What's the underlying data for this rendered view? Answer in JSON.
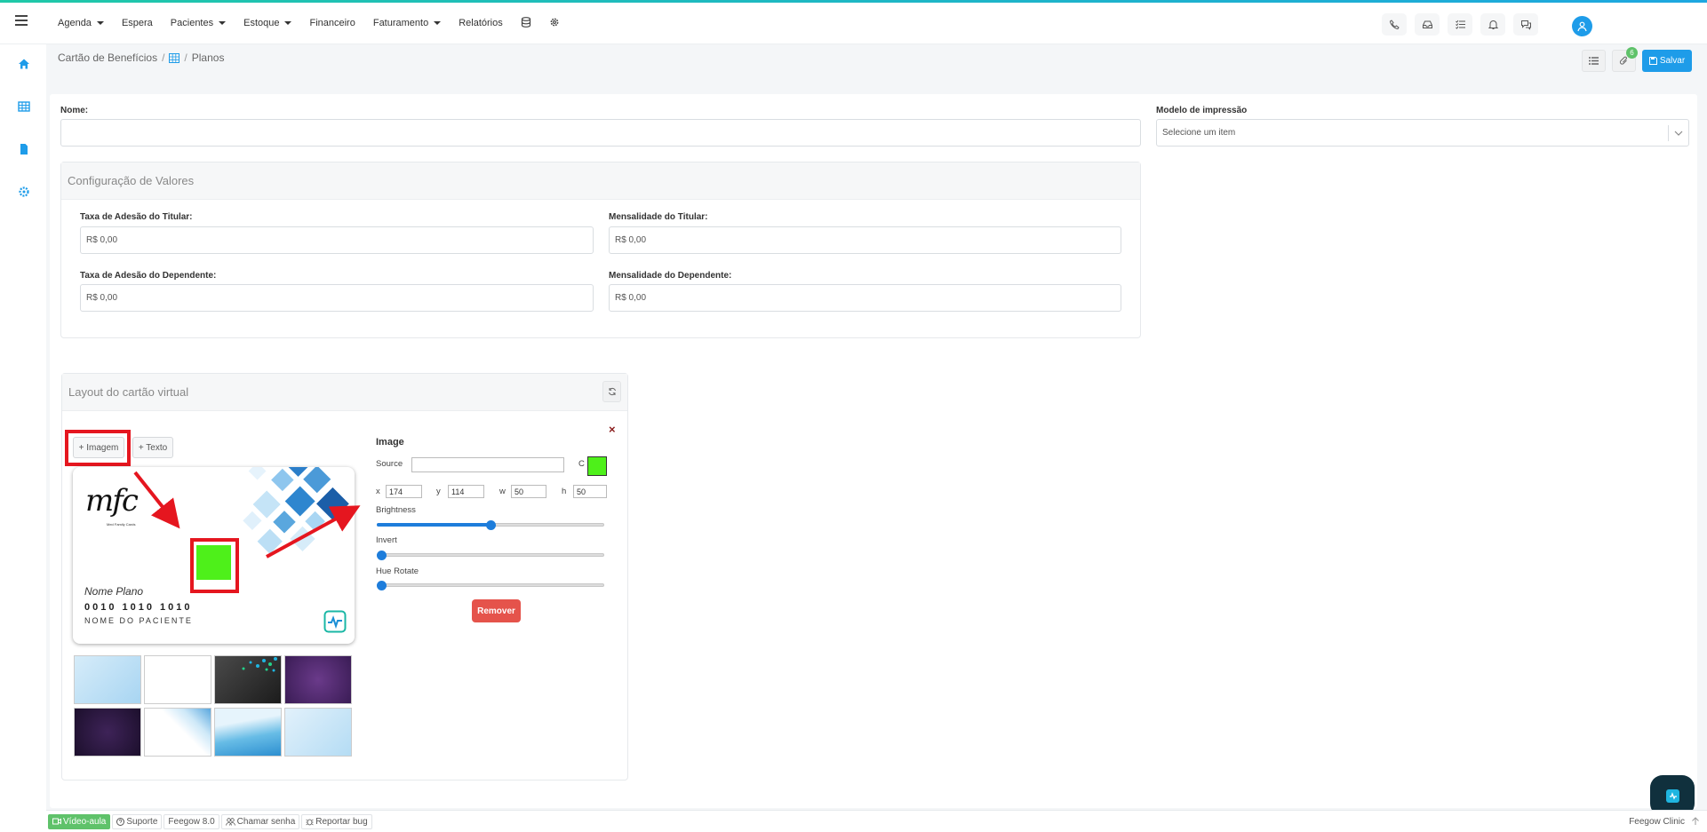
{
  "nav": {
    "items": [
      {
        "label": "Agenda",
        "caret": true
      },
      {
        "label": "Espera",
        "caret": false
      },
      {
        "label": "Pacientes",
        "caret": true
      },
      {
        "label": "Estoque",
        "caret": true
      },
      {
        "label": "Financeiro",
        "caret": false
      },
      {
        "label": "Faturamento",
        "caret": true
      },
      {
        "label": "Relatórios",
        "caret": false
      }
    ]
  },
  "breadcrumb": {
    "root": "Cartão de Benefícios",
    "sep": "/",
    "current": "Planos"
  },
  "header": {
    "badge_count": "6",
    "save_label": "Salvar"
  },
  "form": {
    "nome_label": "Nome:",
    "nome_value": "",
    "modelo_label": "Modelo de impressão",
    "modelo_placeholder": "Selecione um item"
  },
  "valores": {
    "title": "Configuração de Valores",
    "fields": [
      {
        "label": "Taxa de Adesão do Titular:",
        "value": "R$ 0,00"
      },
      {
        "label": "Mensalidade do Titular:",
        "value": "R$ 0,00"
      },
      {
        "label": "Taxa de Adesão do Dependente:",
        "value": "R$ 0,00"
      },
      {
        "label": "Mensalidade do Dependente:",
        "value": "R$ 0,00"
      }
    ]
  },
  "layout": {
    "title": "Layout do cartão virtual",
    "add_image": "+ Imagem",
    "add_text": "+ Texto",
    "card": {
      "logo_text": "mfc",
      "logo_sub": "Med Family Cards",
      "plan_name": "Nome Plano",
      "card_number": "0010 1010 1010",
      "patient_name": "NOME DO PACIENTE",
      "accent_color": "#4ef01a"
    },
    "editor": {
      "title": "Image",
      "source_label": "Source",
      "source_value": "",
      "color_label": "C",
      "color_value": "#4ef01a",
      "x_label": "x",
      "x_value": "174",
      "y_label": "y",
      "y_value": "114",
      "w_label": "w",
      "w_value": "50",
      "h_label": "h",
      "h_value": "50",
      "brightness_label": "Brightness",
      "brightness_level": 0.5,
      "invert_label": "Invert",
      "invert_level": 0,
      "hue_label": "Hue Rotate",
      "hue_level": 0,
      "remove_label": "Remover"
    }
  },
  "footer": {
    "video": "Vídeo-aula",
    "suporte": "Suporte",
    "version": "Feegow 8.0",
    "chamar": "Chamar senha",
    "bug": "Reportar bug",
    "brand": "Feegow Clinic"
  },
  "colors": {
    "accent": "#1e9ce9",
    "danger": "#e5534b",
    "highlight": "#e5161f"
  }
}
